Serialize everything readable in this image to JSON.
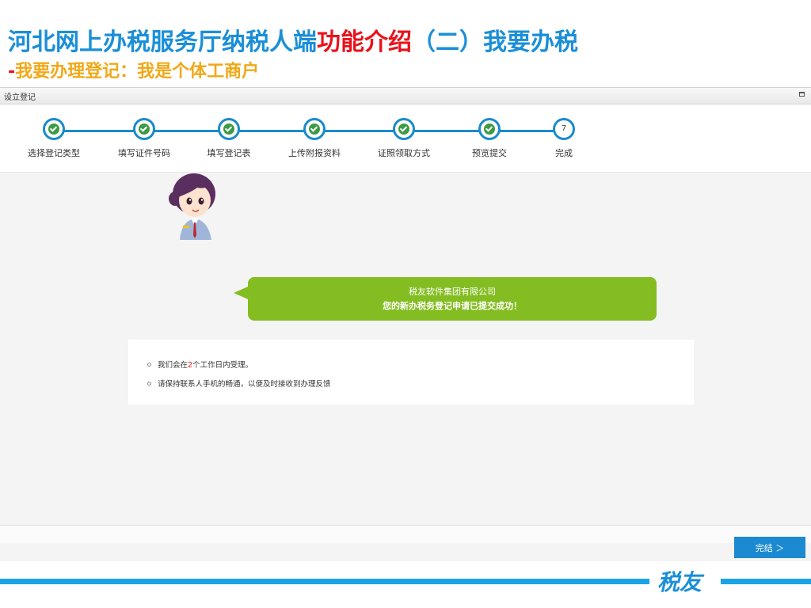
{
  "slide": {
    "title_blue": "河北网上办税服务厅纳税人端",
    "title_red": "功能介绍",
    "title_blue2": "（二）我要办税",
    "subtitle_dash": "-",
    "subtitle": "我要办理登记：我是个体工商户"
  },
  "window": {
    "title": "设立登记"
  },
  "steps": [
    {
      "label": "选择登记类型",
      "state": "done"
    },
    {
      "label": "填写证件号码",
      "state": "done"
    },
    {
      "label": "填写登记表",
      "state": "done"
    },
    {
      "label": "上传附报资料",
      "state": "done"
    },
    {
      "label": "证照领取方式",
      "state": "done"
    },
    {
      "label": "预览提交",
      "state": "done"
    },
    {
      "label": "完成",
      "state": "current",
      "number": "7"
    }
  ],
  "message": {
    "company": "税友软件集团有限公司",
    "text": "您的新办税务登记申请已提交成功！"
  },
  "info": {
    "line1_pre": "我们会在",
    "line1_num": "2",
    "line1_post": "个工作日内受理。",
    "line2": "请保持联系人手机的畅通，以便及时接收到办理反馈"
  },
  "finish_button": {
    "label": "完结 ＞"
  },
  "footer": {
    "logo_text": "税友"
  },
  "colors": {
    "primary_blue": "#1b8acd",
    "title_blue": "#1a8fd8",
    "accent_red": "#e8121b",
    "subtitle_orange": "#f0a817",
    "bubble_green": "#84bd22",
    "check_green": "#3d9a45"
  }
}
